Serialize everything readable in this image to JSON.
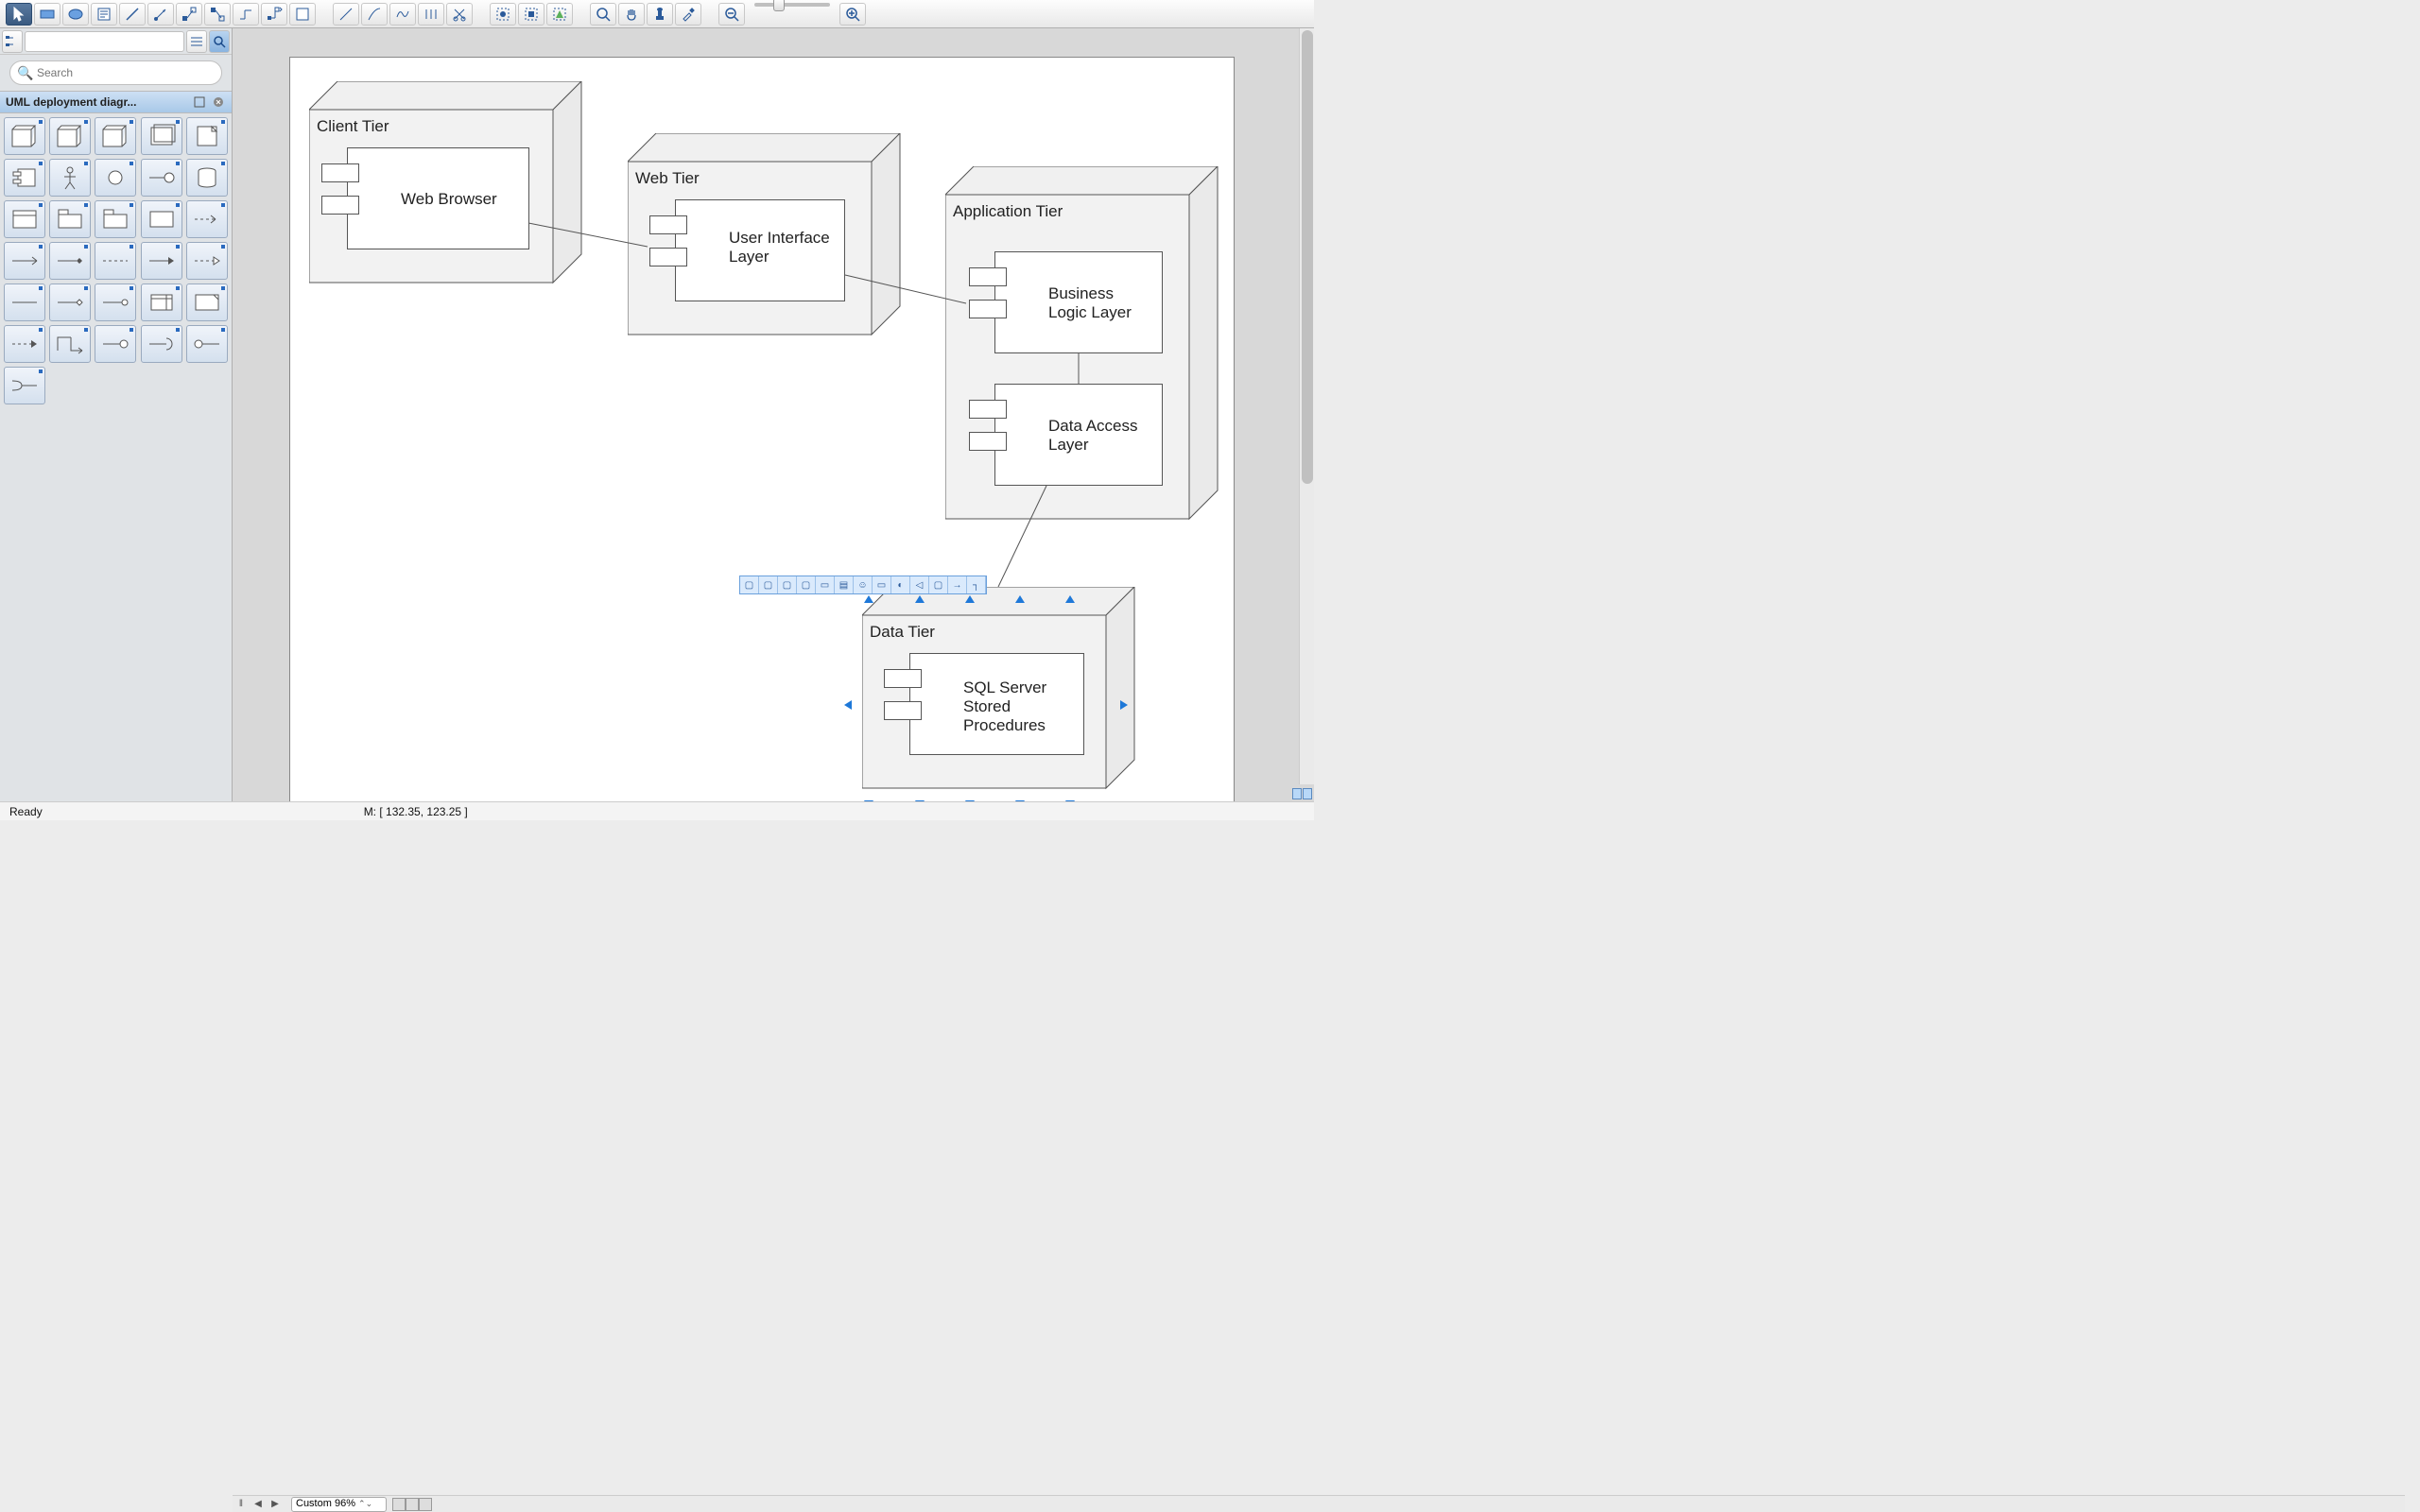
{
  "sidebar": {
    "tree_input": "",
    "search_placeholder": "Search",
    "header_title": "UML deployment diagr..."
  },
  "diagram": {
    "nodes": {
      "client": {
        "title": "Client Tier",
        "component": "Web Browser"
      },
      "web": {
        "title": "Web Tier",
        "component": "User Interface Layer"
      },
      "app": {
        "title": "Application Tier",
        "component1": "Business Logic Layer",
        "component2": "Data Access Layer"
      },
      "data": {
        "title": "Data Tier",
        "component": "SQL Server Stored Procedures"
      }
    }
  },
  "bottombar": {
    "zoom_label": "Custom 96%"
  },
  "status": {
    "ready": "Ready",
    "mouse": "M: [ 132.35, 123.25 ]"
  }
}
